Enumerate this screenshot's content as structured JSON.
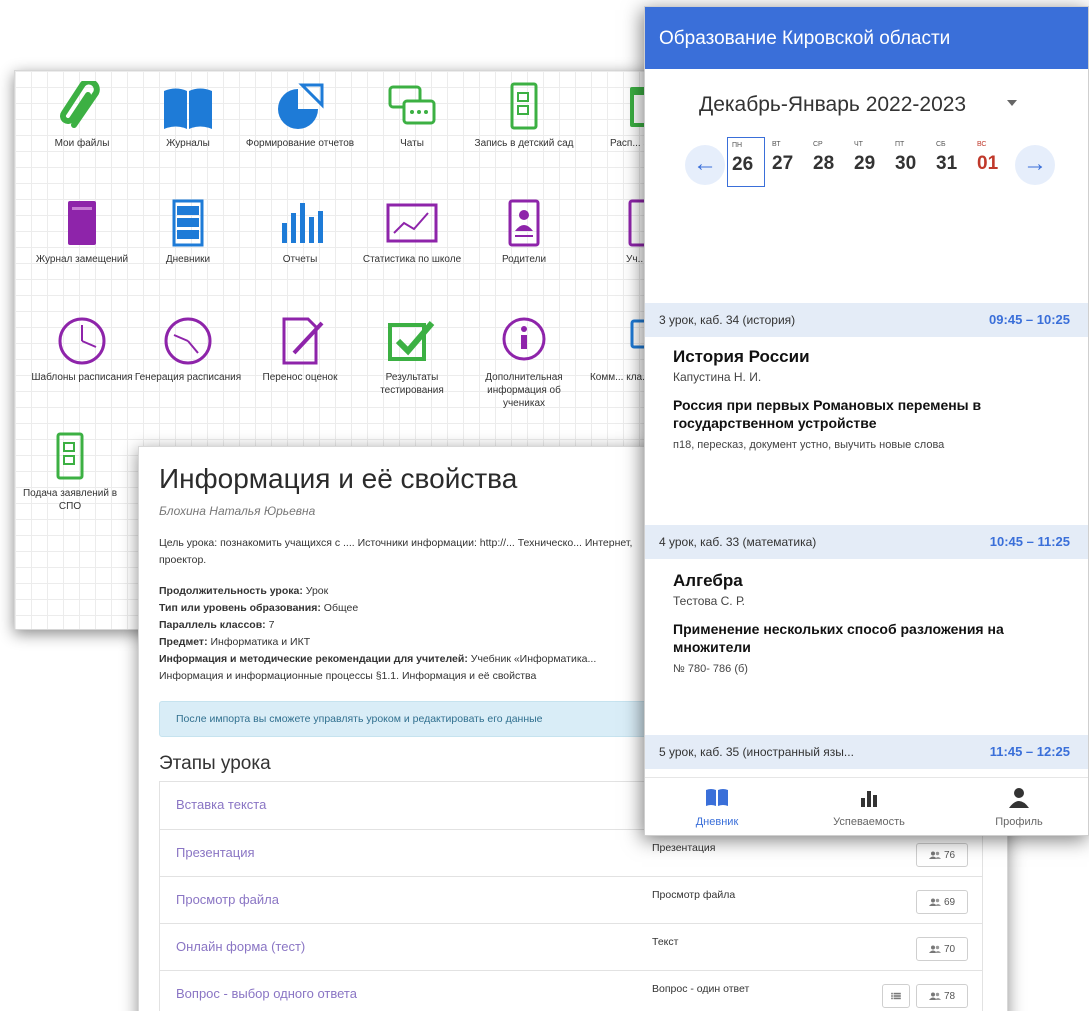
{
  "icon_grid": {
    "tiles": [
      {
        "label": "Мои файлы",
        "icon": "paperclip-icon"
      },
      {
        "label": "Журналы",
        "icon": "book-icon"
      },
      {
        "label": "Формирование отчетов",
        "icon": "pie-chart-icon"
      },
      {
        "label": "Чаты",
        "icon": "chat-icon"
      },
      {
        "label": "Запись в детский сад",
        "icon": "form-document-icon"
      },
      {
        "label": "Расп... за...",
        "icon": "calendar-icon"
      },
      {
        "label": "Журнал замещений",
        "icon": "journal-icon"
      },
      {
        "label": "Дневники",
        "icon": "bookshelf-icon"
      },
      {
        "label": "Отчеты",
        "icon": "bar-chart-icon"
      },
      {
        "label": "Статистика по школе",
        "icon": "line-chart-icon"
      },
      {
        "label": "Родители",
        "icon": "person-card-icon"
      },
      {
        "label": "Уч...",
        "icon": "teacher-icon"
      },
      {
        "label": "Шаблоны расписания",
        "icon": "clock-icon"
      },
      {
        "label": "Генерация расписания",
        "icon": "clock-icon"
      },
      {
        "label": "Перенос оценок",
        "icon": "edit-document-icon"
      },
      {
        "label": "Результаты тестирования",
        "icon": "checkbox-icon"
      },
      {
        "label": "Дополнительная информация об учениках",
        "icon": "info-icon"
      },
      {
        "label": "Комм... кла... руко...",
        "icon": "comment-icon"
      },
      {
        "label": "Подача заявлений в СПО",
        "icon": "form-document-icon"
      }
    ]
  },
  "lesson": {
    "title": "Информация и её свойства",
    "author": "Блохина Наталья Юрьевна",
    "goal": "Цель урока: познакомить учащихся с .... Источники информации: http://... Техническо... Интернет, проектор.",
    "props": [
      {
        "key": "Продолжительность урока:",
        "value": "Урок"
      },
      {
        "key": "Тип или уровень образования:",
        "value": "Общее"
      },
      {
        "key": "Параллель классов:",
        "value": "7"
      },
      {
        "key": "Предмет:",
        "value": "Информатика и ИКТ"
      },
      {
        "key": "Информация и методические рекомендации для учителей:",
        "value": "Учебник «Информатика... Информация и информационные процессы §1.1. Информация и её свойства"
      }
    ],
    "import_alert": "После импорта вы сможете управлять уроком и редактировать его данные",
    "stages_title": "Этапы урока",
    "stages": [
      {
        "name": "Вставка текста",
        "type": "",
        "count": ""
      },
      {
        "name": "Презентация",
        "type": "Презентация",
        "count": "76"
      },
      {
        "name": "Просмотр файла",
        "type": "Просмотр файла",
        "count": "69"
      },
      {
        "name": "Онлайн форма (тест)",
        "type": "Текст",
        "count": "70"
      },
      {
        "name": "Вопрос - выбор одного ответа",
        "type": "Вопрос - один ответ",
        "count": "78"
      }
    ]
  },
  "phone": {
    "app_title": "Образование Кировской области",
    "period": "Декабрь-Январь 2022-2023",
    "arrow_left": "←",
    "arrow_right": "→",
    "days": [
      {
        "dw": "ПН",
        "dn": "26"
      },
      {
        "dw": "ВТ",
        "dn": "27"
      },
      {
        "dw": "СР",
        "dn": "28"
      },
      {
        "dw": "ЧТ",
        "dn": "29"
      },
      {
        "dw": "ПТ",
        "dn": "30"
      },
      {
        "dw": "СБ",
        "dn": "31"
      },
      {
        "dw": "ВС",
        "dn": "01"
      }
    ],
    "lessons": [
      {
        "head": "3 урок, каб. 34 (история)",
        "time": "09:45 – 10:25",
        "subject": "История России",
        "teacher": "Капустина Н. И.",
        "topic": "Россия при первых Романовых  перемены в государственном устройстве",
        "homework": "п18, пересказ, документ устно, выучить новые слова"
      },
      {
        "head": "4 урок, каб. 33 (математика)",
        "time": "10:45 – 11:25",
        "subject": "Алгебра",
        "teacher": "Тестова С. Р.",
        "topic": "Применение нескольких способ разложения на множители",
        "homework": "№ 780- 786 (б)"
      },
      {
        "head": "5 урок, каб. 35 (иностранный язы...",
        "time": "11:45 – 12:25"
      }
    ],
    "bottom_nav": [
      {
        "label": "Дневник",
        "icon": "diary-icon"
      },
      {
        "label": "Успеваемость",
        "icon": "bar-chart-icon"
      },
      {
        "label": "Профиль",
        "icon": "person-icon"
      }
    ]
  },
  "colors": {
    "brand_blue": "#3a6fd9",
    "icon_green": "#3cb043",
    "icon_blue": "#1e7bd7",
    "icon_purple": "#8e24aa",
    "stage_link": "#8a75c4"
  }
}
